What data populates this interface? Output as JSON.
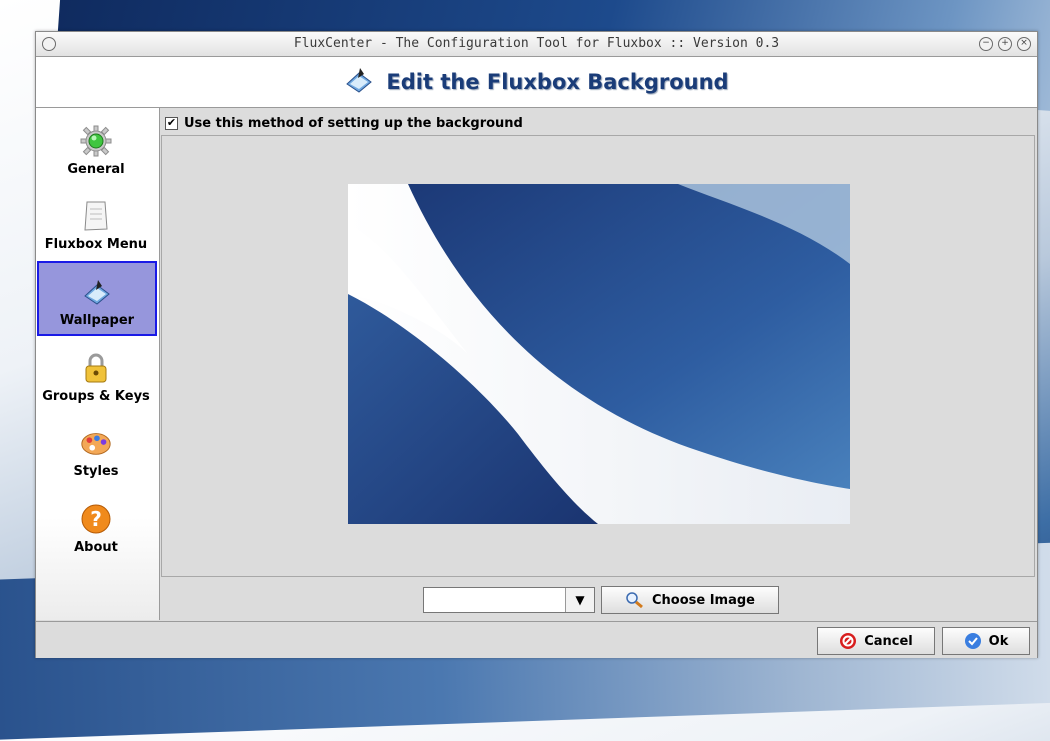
{
  "window": {
    "title": "FluxCenter - The Configuration Tool for Fluxbox :: Version 0.3"
  },
  "header": {
    "title": "Edit the Fluxbox Background"
  },
  "sidebar": {
    "items": [
      {
        "label": "General",
        "icon": "gear-icon",
        "active": false
      },
      {
        "label": "Fluxbox Menu",
        "icon": "document-icon",
        "active": false
      },
      {
        "label": "Wallpaper",
        "icon": "paint-bucket-icon",
        "active": true
      },
      {
        "label": "Groups & Keys",
        "icon": "lock-icon",
        "active": false
      },
      {
        "label": "Styles",
        "icon": "palette-icon",
        "active": false
      },
      {
        "label": "About",
        "icon": "help-icon",
        "active": false
      }
    ]
  },
  "main": {
    "use_method_label": "Use this method of setting up the background",
    "use_method_checked": true,
    "image_select_value": "",
    "choose_image_label": "Choose Image"
  },
  "footer": {
    "cancel_label": "Cancel",
    "ok_label": "Ok"
  },
  "colors": {
    "active_sidebar_bg": "#9696dc",
    "active_sidebar_border": "#1a1ae6",
    "header_text": "#1a3c78"
  }
}
